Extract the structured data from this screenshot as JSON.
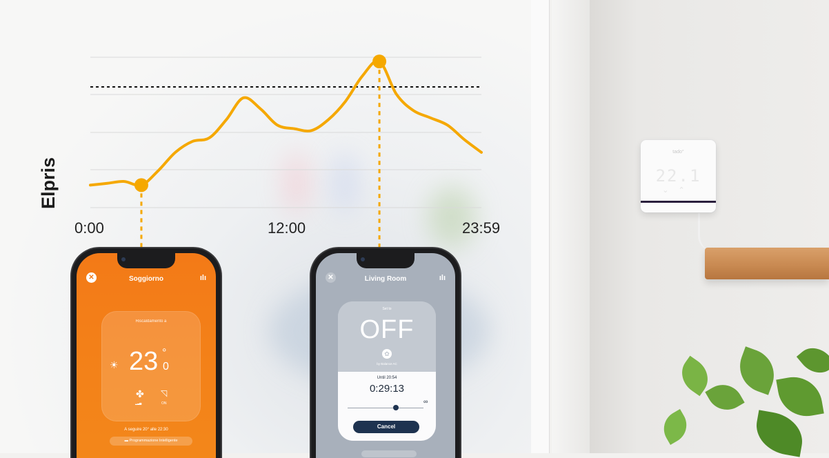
{
  "chart_data": {
    "type": "line",
    "ylabel": "Elpris",
    "xlabel": "",
    "x_ticks": [
      "0:00",
      "12:00",
      "23:59"
    ],
    "x": [
      0,
      1,
      2,
      3,
      4,
      5,
      6,
      7,
      8,
      9,
      10,
      11,
      12,
      13,
      14,
      15,
      16,
      17,
      18,
      19,
      20,
      21,
      22,
      23
    ],
    "series": [
      {
        "values": [
          1.2,
          1.25,
          1.3,
          1.2,
          1.6,
          2.1,
          2.4,
          2.5,
          3.0,
          3.6,
          3.3,
          2.85,
          2.75,
          2.7,
          3.0,
          3.5,
          4.2,
          4.6,
          3.7,
          3.25,
          3.05,
          2.85,
          2.45,
          2.1
        ]
      }
    ],
    "highlights": [
      {
        "x": 3,
        "y": 1.2,
        "color": "#f5a800"
      },
      {
        "x": 17,
        "y": 4.6,
        "color": "#f5a800"
      }
    ],
    "threshold": 3.9,
    "ylim": [
      0.6,
      5.0
    ],
    "grid": true,
    "line_color": "#f5a800"
  },
  "phone_left": {
    "title": "Soggiorno",
    "card_label": "Riscaldamento a",
    "temp_int": "23",
    "temp_deg": "°",
    "temp_dec": "0",
    "sun_icon": "sun-icon",
    "fan_icon": "fan-icon",
    "swing_label": "ON",
    "next_text": "A seguire 20° alle 22:30",
    "prog_label": "Programmazione Intelligente"
  },
  "phone_right": {
    "title": "Living Room",
    "set_to": "Set to",
    "state": "OFF",
    "by": "by Balance AC",
    "until": "Until 20:54",
    "timer": "0:29:13",
    "infinity": "∞",
    "cancel": "Cancel"
  },
  "thermostat": {
    "logo": "tado°",
    "temp": "22.1"
  }
}
